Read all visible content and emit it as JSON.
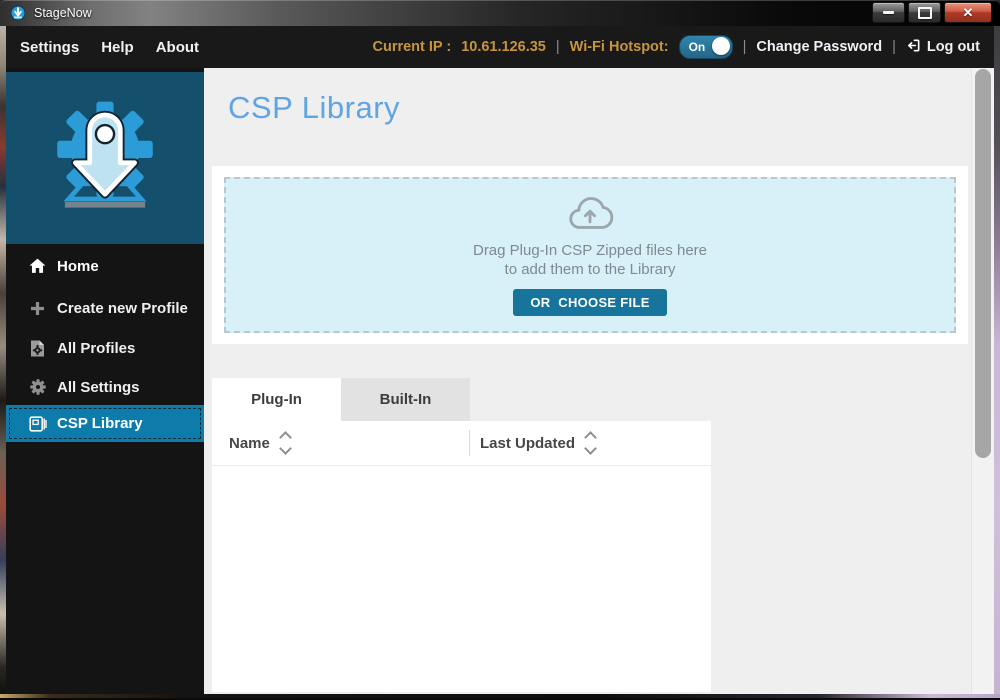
{
  "window": {
    "title": "StageNow"
  },
  "menubar": {
    "items": [
      {
        "label": "Settings"
      },
      {
        "label": "Help"
      },
      {
        "label": "About"
      }
    ]
  },
  "statusbar": {
    "current_ip_label": "Current IP :",
    "current_ip_value": "10.61.126.35",
    "separator": "|",
    "wifi_label": "Wi-Fi Hotspot:",
    "wifi_state": "On",
    "change_password": "Change Password",
    "logout": "Log out"
  },
  "sidebar": {
    "items": [
      {
        "label": "Home"
      },
      {
        "label": "Create new Profile"
      },
      {
        "label": "All Profiles"
      },
      {
        "label": "All Settings"
      },
      {
        "label": "CSP Library"
      }
    ]
  },
  "main": {
    "page_title": "CSP Library",
    "dropzone": {
      "line1": "Drag Plug-In CSP Zipped files here",
      "line2": "to add them to the Library",
      "button": "OR  CHOOSE FILE"
    },
    "tabs": [
      {
        "label": "Plug-In"
      },
      {
        "label": "Built-In"
      }
    ],
    "table": {
      "columns": [
        {
          "label": "Name"
        },
        {
          "label": "Last Updated"
        }
      ],
      "rows": []
    }
  },
  "colors": {
    "accent_amber": "#C6953C",
    "selected_blue": "#0E7CAB",
    "title_blue": "#5FA5E6",
    "button_teal": "#17749C",
    "dropzone_bg": "#D8F1F8"
  }
}
